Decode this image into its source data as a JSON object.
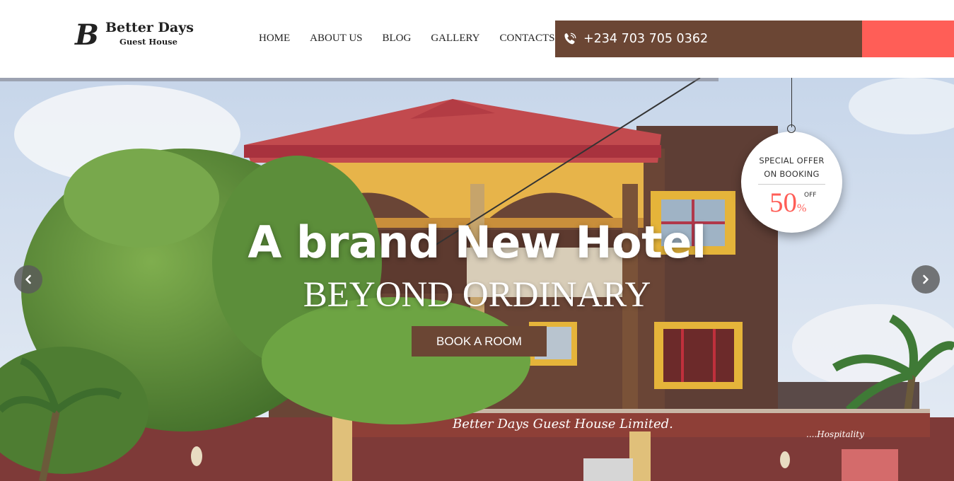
{
  "logo": {
    "mark": "B",
    "title": "Better Days",
    "subtitle": "Guest House"
  },
  "nav": {
    "items": [
      {
        "label": "HOME"
      },
      {
        "label": "ABOUT US"
      },
      {
        "label": "BLOG"
      },
      {
        "label": "GALLERY"
      },
      {
        "label": "CONTACTS"
      }
    ]
  },
  "contact": {
    "icon": "phone-icon",
    "phone": "+234 703 705 0362"
  },
  "hero": {
    "title": "A brand New Hotel",
    "subtitle": "BEYOND ORDINARY",
    "cta": "BOOK A ROOM",
    "sign_text": "Better Days Guest House Limited.",
    "sign_small": "....Hospitality",
    "prev_icon": "chevron-left-icon",
    "next_icon": "chevron-right-icon"
  },
  "offer": {
    "line1": "SPECIAL OFFER",
    "line2": "ON BOOKING",
    "discount": "50",
    "unit": "%",
    "off_label": "OFF"
  },
  "colors": {
    "brand_brown": "#6b4634",
    "accent_coral": "#ff5e57",
    "header_bg": "#ffffff"
  }
}
